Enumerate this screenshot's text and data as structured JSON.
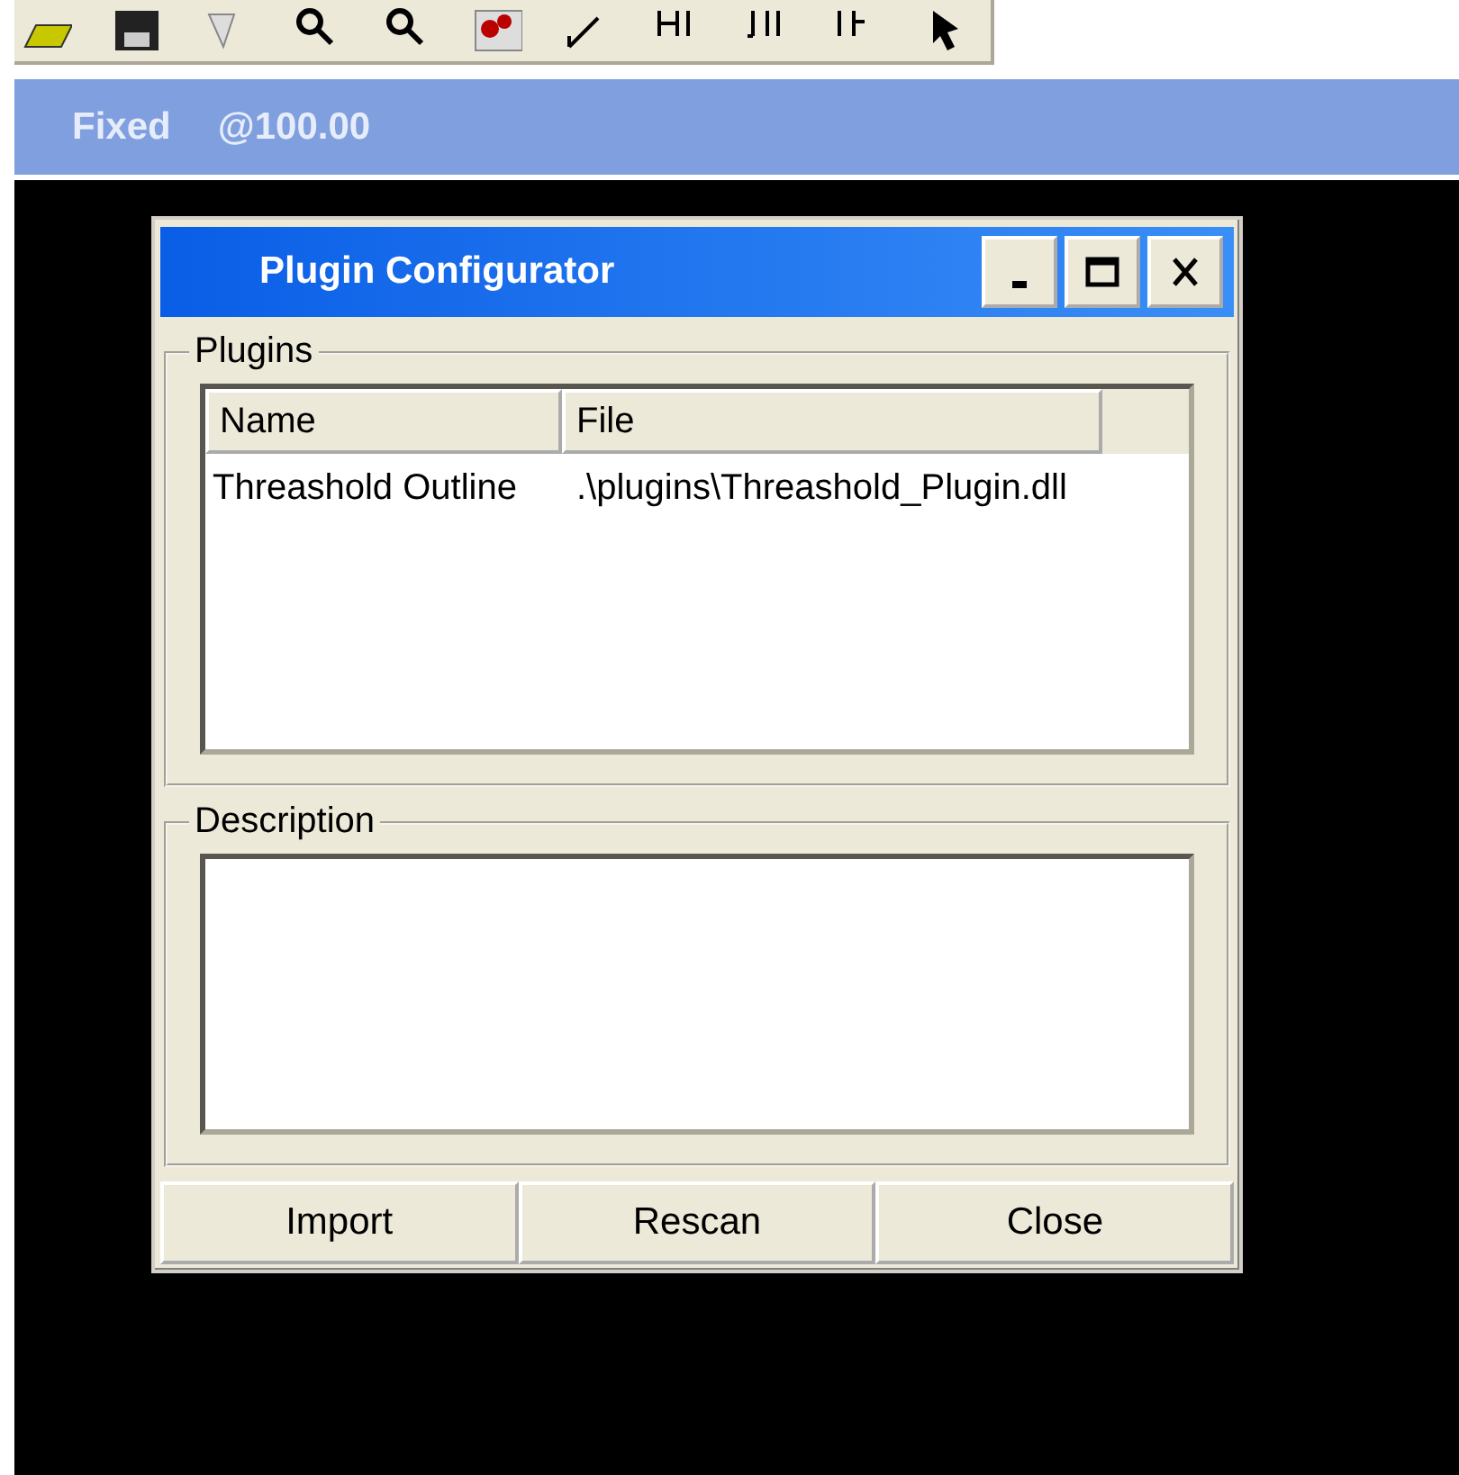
{
  "status_bar": {
    "mode": "Fixed",
    "zoom": "@100.00"
  },
  "dialog": {
    "title": "Plugin Configurator",
    "window_buttons": [
      {
        "kind": "minimize"
      },
      {
        "kind": "maximize"
      },
      {
        "kind": "close"
      }
    ],
    "plugins_group": {
      "label": "Plugins",
      "columns": [
        "Name",
        "File"
      ],
      "rows": [
        {
          "name": "Threashold Outline",
          "file": ".\\plugins\\Threashold_Plugin.dll"
        }
      ]
    },
    "description_group": {
      "label": "Description"
    },
    "buttons": [
      "Import",
      "Rescan",
      "Close"
    ]
  }
}
